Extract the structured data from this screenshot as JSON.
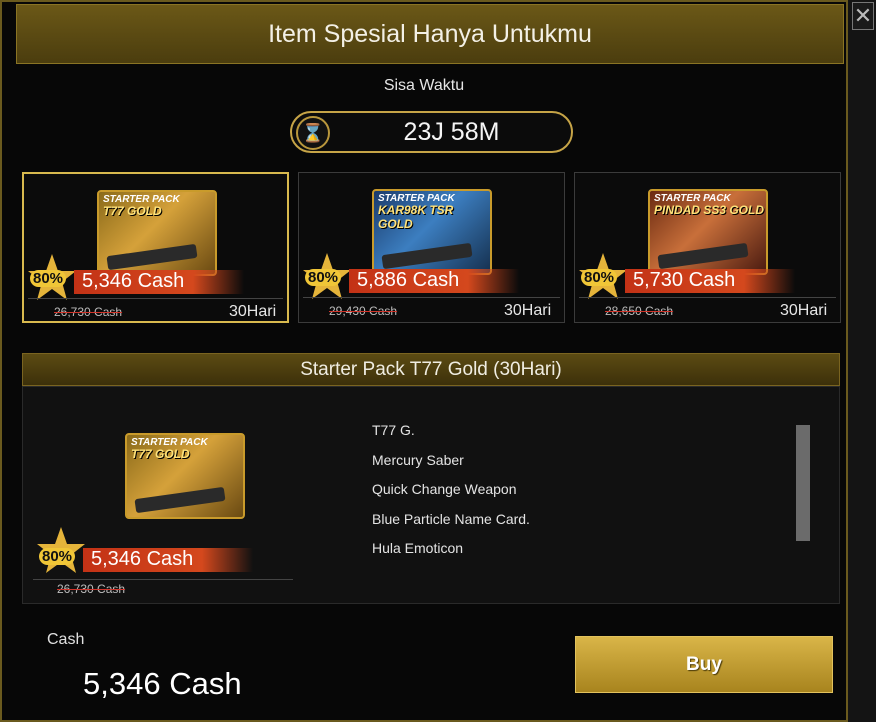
{
  "dialog": {
    "title": "Item Spesial Hanya Untukmu",
    "close_glyph": "✕"
  },
  "timer": {
    "label": "Sisa Waktu",
    "value": "23J 58M",
    "icon": "hourglass-icon"
  },
  "offers": [
    {
      "pack_header": "STARTER PACK",
      "pack_name": "T77 GOLD",
      "discount": "80%",
      "price": "5,346 Cash",
      "old_price": "26,730 Cash",
      "duration": "30Hari",
      "selected": true
    },
    {
      "pack_header": "STARTER PACK",
      "pack_name": "KAR98K TSR GOLD",
      "discount": "80%",
      "price": "5,886 Cash",
      "old_price": "29,430 Cash",
      "duration": "30Hari",
      "selected": false
    },
    {
      "pack_header": "STARTER PACK",
      "pack_name": "PINDAD SS3 GOLD",
      "discount": "80%",
      "price": "5,730 Cash",
      "old_price": "28,650 Cash",
      "duration": "30Hari",
      "selected": false
    }
  ],
  "detail": {
    "title": "Starter Pack T77 Gold (30Hari)",
    "pack_header": "STARTER PACK",
    "pack_name": "T77 GOLD",
    "discount": "80%",
    "price": "5,346 Cash",
    "old_price": "26,730 Cash",
    "contents": [
      "T77 G.",
      "Mercury Saber",
      "Quick Change Weapon",
      "Blue Particle Name Card.",
      "Hula Emoticon"
    ]
  },
  "footer": {
    "cash_label": "Cash",
    "cash_value": "5,346 Cash",
    "buy_label": "Buy"
  },
  "colors": {
    "accent_gold": "#c6a447",
    "price_red": "#d4481d",
    "badge_yellow": "#f0c637"
  }
}
